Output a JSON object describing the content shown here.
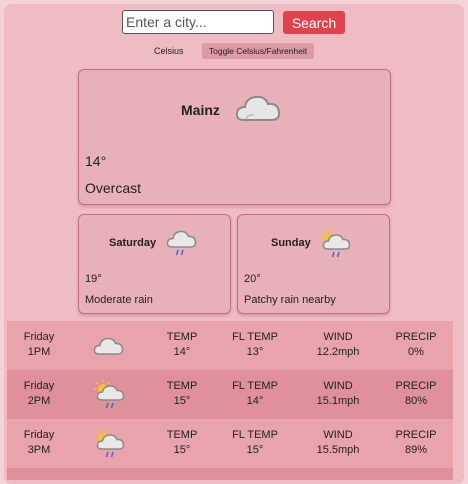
{
  "search": {
    "placeholder": "Enter a city...",
    "button": "Search"
  },
  "units": {
    "label": "Celsius",
    "toggle": "Toggle Celsius/Fahrenheit"
  },
  "current": {
    "city": "Mainz",
    "temp": "14°",
    "condition": "Overcast",
    "icon": "cloud-icon"
  },
  "forecast": [
    {
      "day": "Saturday",
      "temp": "19°",
      "condition": "Moderate rain",
      "icon": "rain-cloud-icon"
    },
    {
      "day": "Sunday",
      "temp": "20°",
      "condition": "Patchy rain nearby",
      "icon": "sun-rain-cloud-icon"
    }
  ],
  "hourly": [
    {
      "day": "Friday",
      "time": "1PM",
      "icon": "cloud-icon",
      "temp_label": "TEMP",
      "temp": "14°",
      "fl_label": "FL TEMP",
      "fl": "13°",
      "wind_label": "WIND",
      "wind": "12.2mph",
      "precip_label": "PRECIP",
      "precip": "0%"
    },
    {
      "day": "Friday",
      "time": "2PM",
      "icon": "sun-rain-cloud-icon",
      "temp_label": "TEMP",
      "temp": "15°",
      "fl_label": "FL TEMP",
      "fl": "14°",
      "wind_label": "WIND",
      "wind": "15.1mph",
      "precip_label": "PRECIP",
      "precip": "80%"
    },
    {
      "day": "Friday",
      "time": "3PM",
      "icon": "sun-rain-cloud-icon",
      "temp_label": "TEMP",
      "temp": "15°",
      "fl_label": "FL TEMP",
      "fl": "15°",
      "wind_label": "WIND",
      "wind": "15.5mph",
      "precip_label": "PRECIP",
      "precip": "89%"
    }
  ],
  "colors": {
    "accent": "#e0424e",
    "background": "#efbcc4",
    "card": "#e8b0b8"
  }
}
